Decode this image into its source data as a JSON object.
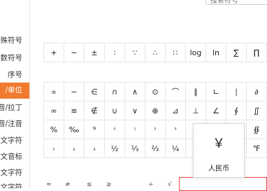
{
  "search": {
    "placeholder": "搜索符号"
  },
  "sidebar": {
    "items": [
      {
        "label": "殊符号",
        "active": false
      },
      {
        "label": "数符号",
        "active": false
      },
      {
        "label": "序号",
        "active": false
      },
      {
        "label": "/单位",
        "active": true
      },
      {
        "label": "音/拉丁",
        "active": false
      },
      {
        "label": "音/注音",
        "active": false
      },
      {
        "label": "文字符",
        "active": false
      },
      {
        "label": "文音标",
        "active": false
      },
      {
        "label": "文字符",
        "active": false
      },
      {
        "label": "文字符",
        "active": false
      }
    ]
  },
  "grid_top": {
    "rows": [
      [
        "+",
        "−",
        "±",
        "∶",
        "∵",
        "∴",
        "∷",
        "log",
        "ln",
        "∑",
        "∏"
      ]
    ]
  },
  "grid_main": {
    "rows": [
      [
        "∝",
        "∽",
        "∈",
        "∩",
        "∧",
        "⊙",
        "⌒",
        "∥",
        "∟",
        "∣",
        "∂"
      ],
      [
        "∞",
        "≌",
        "∉",
        "∪",
        "∨",
        "⊕",
        "⊿",
        "⊥",
        "∠",
        "∮",
        "∬"
      ],
      [
        "%",
        "‰",
        "⁹",
        "⁰",
        "¹",
        "²",
        "³",
        "",
        "",
        "",
        "∯"
      ],
      [
        "₁",
        "₂",
        "₃",
        "½",
        "⅓",
        "⅔",
        "¼",
        "",
        "",
        "",
        "℉"
      ]
    ]
  },
  "popup": {
    "symbol": "￥",
    "name": "人民币"
  },
  "bottom_partial": [
    "≈",
    "≠",
    "≤",
    "≥",
    "÷",
    "√"
  ]
}
